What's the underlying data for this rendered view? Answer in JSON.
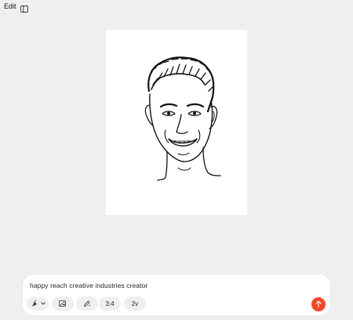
{
  "topbar": {
    "edit_label": "Edit",
    "sidebar_icon": "sidebar-toggle-icon"
  },
  "canvas": {
    "image_subject": "ink sketch portrait of a smiling man"
  },
  "composer": {
    "prompt_text": "happy reach creative industries creator",
    "style_icon": "style-picker-icon",
    "image_ref_icon": "image-reference-icon",
    "pen_icon": "pen-sparkle-icon",
    "aspect_ratio": "3:4",
    "variations": "2v",
    "send_icon": "arrow-up-icon",
    "accent_color": "#ee4a2a"
  }
}
